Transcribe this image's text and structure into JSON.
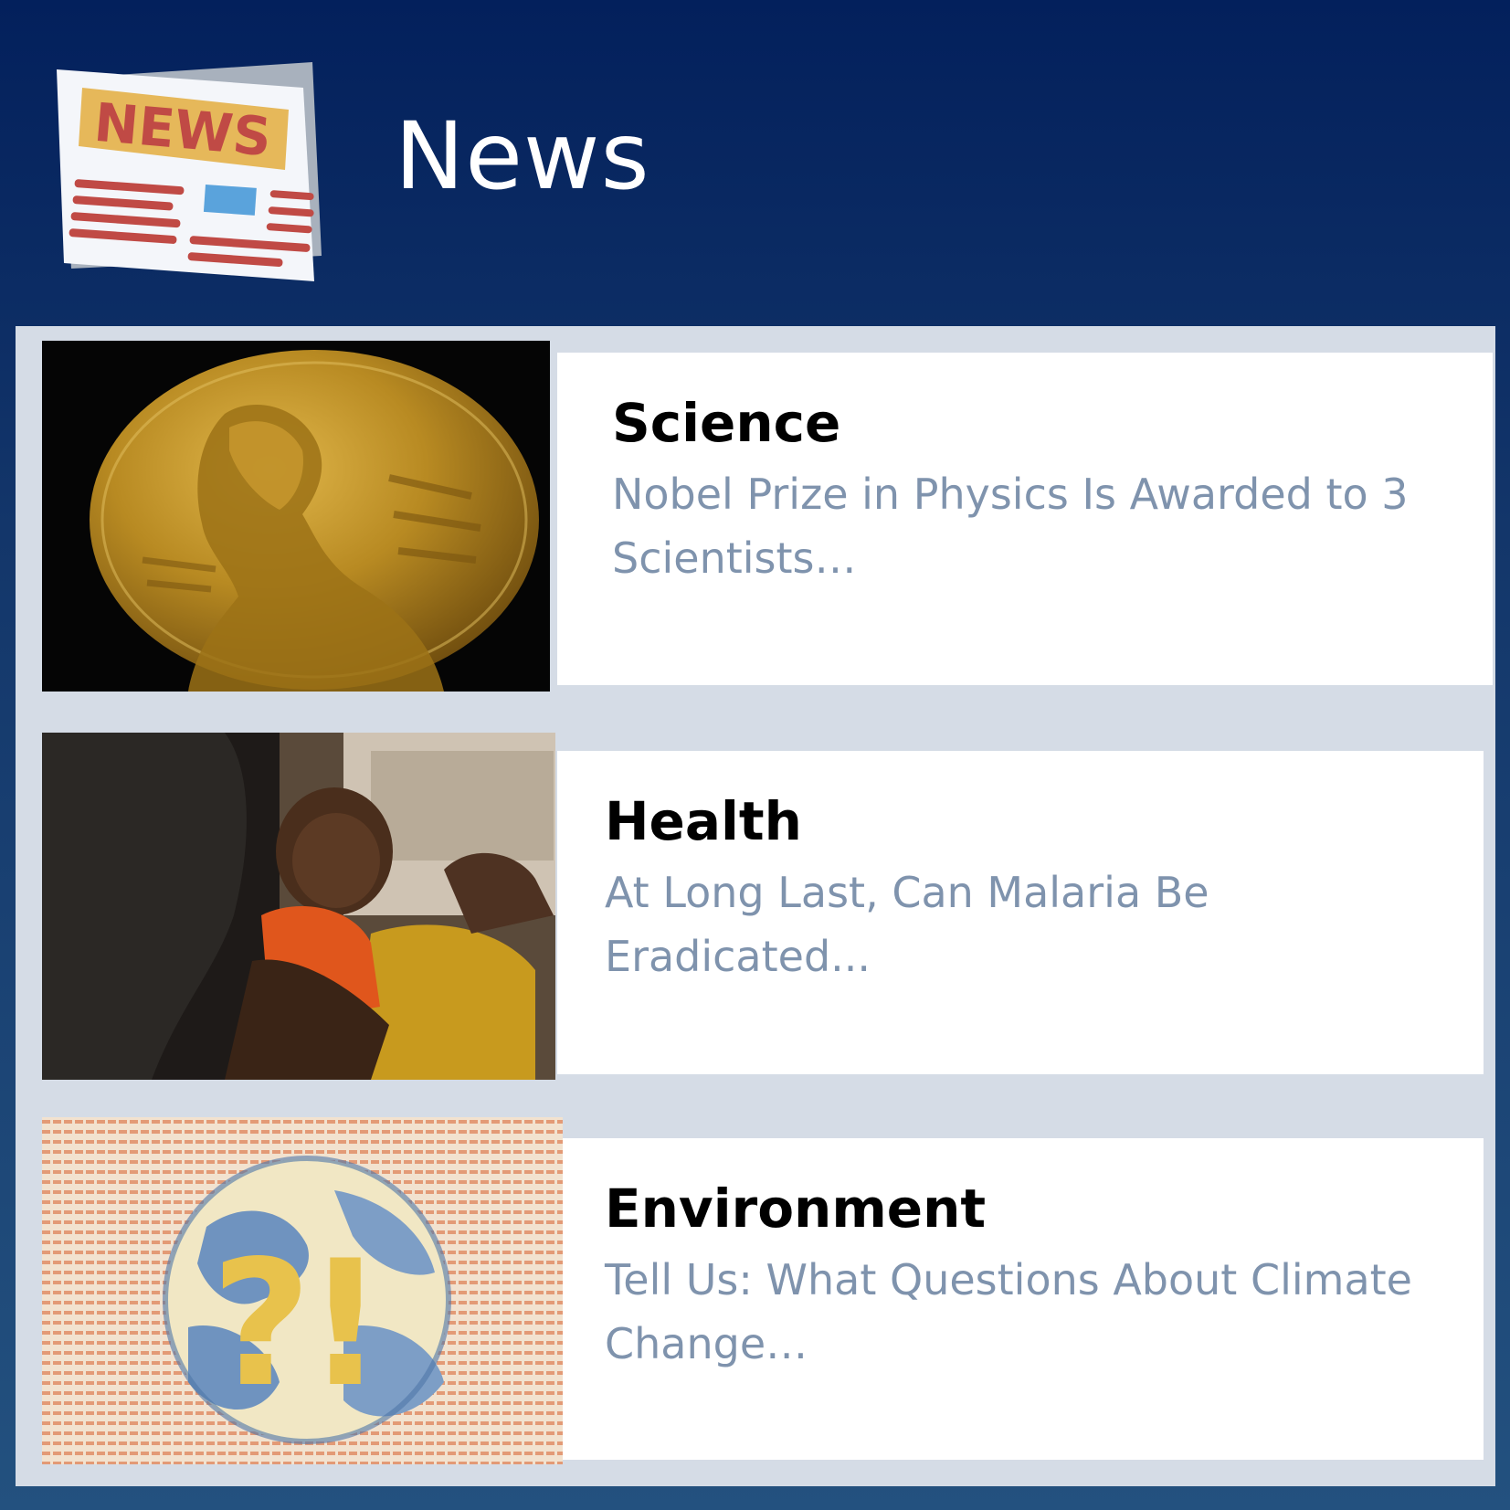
{
  "header": {
    "title": "News",
    "logo_label": "NEWS"
  },
  "articles": [
    {
      "category": "Science",
      "headline": "Nobel Prize in Physics Is Awarded to 3 Scientists…",
      "thumbnail": "nobel-medal-image"
    },
    {
      "category": "Health",
      "headline": "At Long Last, Can Malaria Be Eradicated...",
      "thumbnail": "baby-vaccination-image"
    },
    {
      "category": "Environment",
      "headline": "Tell Us: What Questions About Climate Change…",
      "thumbnail": "globe-question-exclamation-image"
    }
  ],
  "colors": {
    "header_gradient_top": "#03205c",
    "header_gradient_bottom": "#23517f",
    "panel": "#d5dce6",
    "card": "#ffffff",
    "category_text": "#000000",
    "headline_text": "#7f93ad",
    "logo_label": "#c04a45",
    "logo_label_bg": "#e6b85a"
  }
}
